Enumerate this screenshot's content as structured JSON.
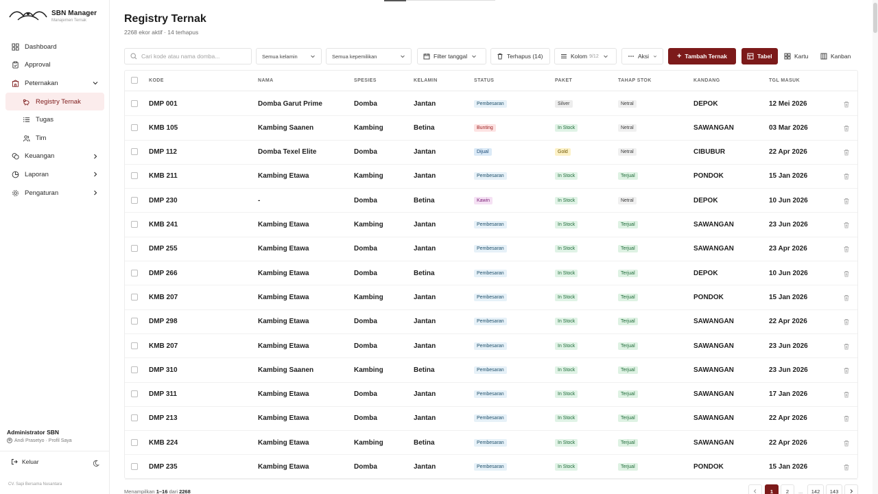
{
  "brand": {
    "title": "SBN Manager",
    "subtitle": "Manajemen Ternak"
  },
  "sidebar": {
    "items": [
      {
        "label": "Dashboard",
        "icon": "grid-icon"
      },
      {
        "label": "Approval",
        "icon": "clipboard-icon"
      },
      {
        "label": "Peternakan",
        "icon": "building-icon",
        "expanded": true
      },
      {
        "label": "Registry Ternak",
        "icon": "sheep-icon",
        "active": true
      },
      {
        "label": "Tugas",
        "icon": "list-icon"
      },
      {
        "label": "Tim",
        "icon": "users-icon"
      },
      {
        "label": "Keuangan",
        "icon": "coins-icon"
      },
      {
        "label": "Laporan",
        "icon": "chart-pie-icon"
      },
      {
        "label": "Pengaturan",
        "icon": "gear-icon"
      }
    ],
    "user_name": "Administrator SBN",
    "user_sub": "Andi Prasetyo · Profil Saya",
    "logout_label": "Keluar",
    "company": "CV. Sapi Bersama Nusantara"
  },
  "page": {
    "title": "Registry Ternak",
    "subtitle": "2268 ekor aktif · 14 terhapus"
  },
  "toolbar": {
    "search_placeholder": "Cari kode atau nama domba...",
    "gender_select": "Semua kelamin",
    "ownership_select": "Semua kepemilikan",
    "date_filter": "Filter tanggal",
    "deleted": "Terhapus (14)",
    "columns": "Kolom",
    "columns_count": "9/12",
    "actions": "Aksi",
    "add": "Tambah Ternak",
    "view_table": "Tabel",
    "view_card": "Kartu",
    "view_kanban": "Kanban"
  },
  "table": {
    "headers": {
      "kode": "KODE",
      "nama": "NAMA",
      "spesies": "SPESIES",
      "kelamin": "KELAMIN",
      "status": "STATUS",
      "paket": "PAKET",
      "tahap": "TAHAP STOK",
      "kandang": "KANDANG",
      "tgl": "TGL MASUK"
    },
    "rows": [
      {
        "kode": "DMP 001",
        "nama": "Domba Garut Prime",
        "spesies": "Domba",
        "kelamin": "Jantan",
        "status": "Pembesaran",
        "paket": "Silver",
        "tahap": "Netral",
        "kandang": "DEPOK",
        "tgl": "12 Mei 2026"
      },
      {
        "kode": "KMB 105",
        "nama": "Kambing Saanen",
        "spesies": "Kambing",
        "kelamin": "Betina",
        "status": "Bunting",
        "paket": "In Stock",
        "tahap": "Netral",
        "kandang": "SAWANGAN",
        "tgl": "03 Mar 2026"
      },
      {
        "kode": "DMP 112",
        "nama": "Domba Texel Elite",
        "spesies": "Domba",
        "kelamin": "Jantan",
        "status": "Dijual",
        "paket": "Gold",
        "tahap": "Netral",
        "kandang": "CIBUBUR",
        "tgl": "22 Apr 2026"
      },
      {
        "kode": "KMB 211",
        "nama": "Kambing Etawa",
        "spesies": "Kambing",
        "kelamin": "Jantan",
        "status": "Pembesaran",
        "paket": "In Stock",
        "tahap": "Terjual",
        "kandang": "PONDOK",
        "tgl": "15 Jan 2026"
      },
      {
        "kode": "DMP 230",
        "nama": "-",
        "spesies": "Domba",
        "kelamin": "Betina",
        "status": "Kawin",
        "paket": "In Stock",
        "tahap": "Netral",
        "kandang": "DEPOK",
        "tgl": "10 Jun 2026"
      },
      {
        "kode": "KMB 241",
        "nama": "Kambing Etawa",
        "spesies": "Kambing",
        "kelamin": "Jantan",
        "status": "Pembesaran",
        "paket": "In Stock",
        "tahap": "Terjual",
        "kandang": "SAWANGAN",
        "tgl": "23 Jun 2026"
      },
      {
        "kode": "DMP 255",
        "nama": "Kambing Etawa",
        "spesies": "Domba",
        "kelamin": "Jantan",
        "status": "Pembesaran",
        "paket": "In Stock",
        "tahap": "Terjual",
        "kandang": "SAWANGAN",
        "tgl": "23 Apr 2026"
      },
      {
        "kode": "DMP 266",
        "nama": "Kambing Etawa",
        "spesies": "Domba",
        "kelamin": "Betina",
        "status": "Pembesaran",
        "paket": "In Stock",
        "tahap": "Terjual",
        "kandang": "DEPOK",
        "tgl": "10 Jun 2026"
      },
      {
        "kode": "KMB 207",
        "nama": "Kambing Etawa",
        "spesies": "Kambing",
        "kelamin": "Jantan",
        "status": "Pembesaran",
        "paket": "In Stock",
        "tahap": "Terjual",
        "kandang": "PONDOK",
        "tgl": "15 Jan 2026"
      },
      {
        "kode": "DMP 298",
        "nama": "Kambing Etawa",
        "spesies": "Domba",
        "kelamin": "Jantan",
        "status": "Pembesaran",
        "paket": "In Stock",
        "tahap": "Terjual",
        "kandang": "SAWANGAN",
        "tgl": "22 Apr 2026"
      },
      {
        "kode": "KMB 207",
        "nama": "Kambing Etawa",
        "spesies": "Domba",
        "kelamin": "Jantan",
        "status": "Pembesaran",
        "paket": "In Stock",
        "tahap": "Terjual",
        "kandang": "SAWANGAN",
        "tgl": "23 Jun 2026"
      },
      {
        "kode": "DMP 310",
        "nama": "Kambing Saanen",
        "spesies": "Kambing",
        "kelamin": "Betina",
        "status": "Pembesaran",
        "paket": "In Stock",
        "tahap": "Terjual",
        "kandang": "SAWANGAN",
        "tgl": "23 Jun 2026"
      },
      {
        "kode": "DMP 311",
        "nama": "Kambing Etawa",
        "spesies": "Domba",
        "kelamin": "Jantan",
        "status": "Pembesaran",
        "paket": "In Stock",
        "tahap": "Terjual",
        "kandang": "SAWANGAN",
        "tgl": "17 Jan 2026"
      },
      {
        "kode": "DMP 213",
        "nama": "Kambing Etawa",
        "spesies": "Domba",
        "kelamin": "Jantan",
        "status": "Pembesaran",
        "paket": "In Stock",
        "tahap": "Terjual",
        "kandang": "SAWANGAN",
        "tgl": "22 Apr 2026"
      },
      {
        "kode": "KMB 224",
        "nama": "Kambing Etawa",
        "spesies": "Kambing",
        "kelamin": "Betina",
        "status": "Pembesaran",
        "paket": "In Stock",
        "tahap": "Terjual",
        "kandang": "SAWANGAN",
        "tgl": "22 Apr 2026"
      },
      {
        "kode": "DMP 235",
        "nama": "Kambing Etawa",
        "spesies": "Domba",
        "kelamin": "Jantan",
        "status": "Pembesaran",
        "paket": "In Stock",
        "tahap": "Terjual",
        "kandang": "PONDOK",
        "tgl": "15 Jan 2026"
      }
    ]
  },
  "pagination": {
    "info_prefix": "Menampilkan",
    "info_range": "1–16",
    "info_mid": "dari",
    "info_total": "2268",
    "pages": [
      "1",
      "2",
      "...",
      "142",
      "143"
    ],
    "current": "1"
  },
  "colors": {
    "accent": "#7c1a1a",
    "accent_soft": "#fbecec"
  }
}
